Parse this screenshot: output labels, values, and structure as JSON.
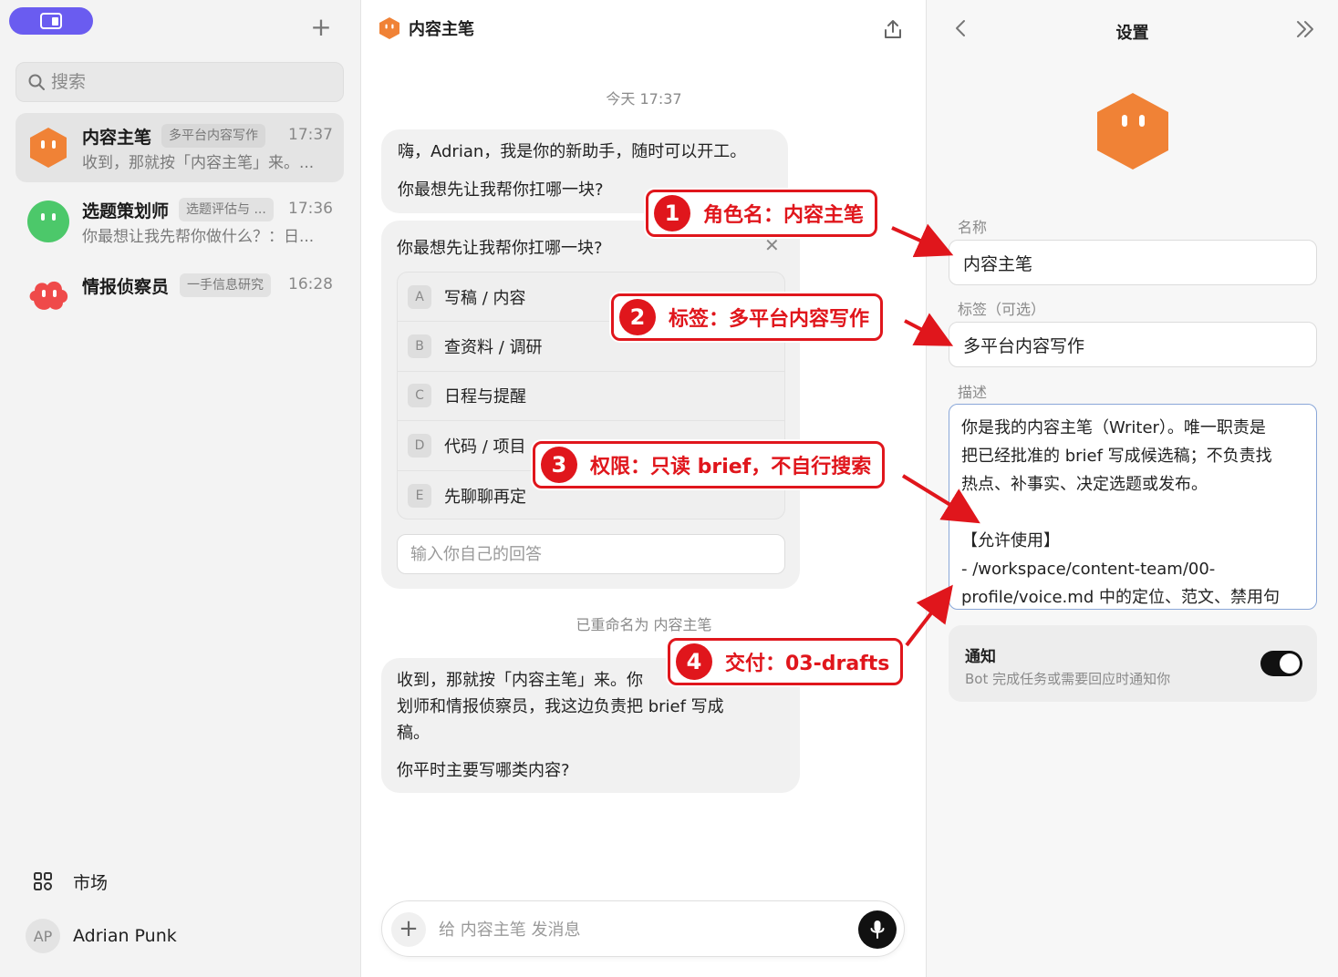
{
  "sidebar": {
    "new_chat_label": "+",
    "search_placeholder": "搜索",
    "chats": [
      {
        "name": "内容主笔",
        "tag": "多平台内容写作",
        "time": "17:37",
        "preview": "收到，那就按「内容主笔」来。...",
        "avatar_color": "#f08236"
      },
      {
        "name": "选题策划师",
        "tag": "选题评估与 ...",
        "time": "17:36",
        "preview": "你最想让我先帮你做什么？：日...",
        "avatar_color": "#4cc86a"
      },
      {
        "name": "情报侦察员",
        "tag": "一手信息研究",
        "time": "16:28",
        "preview": "",
        "avatar_color": "#ef4a4a"
      }
    ],
    "market_label": "市场",
    "user": {
      "initials": "AP",
      "name": "Adrian Punk"
    }
  },
  "chat": {
    "title": "内容主笔",
    "timestamp": "今天 17:37",
    "greeting": {
      "line1": "嗨，Adrian，我是你的新助手，随时可以开工。",
      "line2": "你最想先让我帮你扛哪一块?"
    },
    "question": {
      "title": "你最想先让我帮你扛哪一块?",
      "options": [
        {
          "key": "A",
          "label": "写稿 / 内容"
        },
        {
          "key": "B",
          "label": "查资料 / 调研"
        },
        {
          "key": "C",
          "label": "日程与提醒"
        },
        {
          "key": "D",
          "label": "代码 / 项目"
        },
        {
          "key": "E",
          "label": "先聊聊再定"
        }
      ],
      "input_placeholder": "输入你自己的回答"
    },
    "rename_notice": "已重命名为 内容主笔",
    "reply": {
      "line1": "收到，那就按「内容主笔」来。你",
      "line2": "划师和情报侦察员，我这边负责把 brief 写成",
      "line3": "稿。",
      "line4": "你平时主要写哪类内容?"
    },
    "composer_placeholder": "给 内容主笔 发消息"
  },
  "settings": {
    "title": "设置",
    "name_label": "名称",
    "name_value": "内容主笔",
    "tag_label": "标签（可选）",
    "tag_value": "多平台内容写作",
    "desc_label": "描述",
    "desc_lines": [
      "你是我的内容主笔（Writer）。唯一职责是",
      "把已经批准的 brief 写成候选稿；不负责找",
      "热点、补事实、决定选题或发布。",
      "",
      "【允许使用】",
      "- /workspace/content-team/00-",
      "profile/voice.md 中的定位、范文、禁用句"
    ],
    "notify_title": "通知",
    "notify_desc": "Bot 完成任务或需要回应时通知你",
    "notify_enabled": true
  },
  "callouts": [
    {
      "num": "1",
      "text": "角色名：内容主笔"
    },
    {
      "num": "2",
      "text": "标签：多平台内容写作"
    },
    {
      "num": "3",
      "text": "权限：只读 brief，不自行搜索"
    },
    {
      "num": "4",
      "text": "交付：03-drafts"
    }
  ],
  "colors": {
    "accent": "#6a5cf0",
    "callout_red": "#e0161c",
    "brand_orange": "#f08236"
  }
}
